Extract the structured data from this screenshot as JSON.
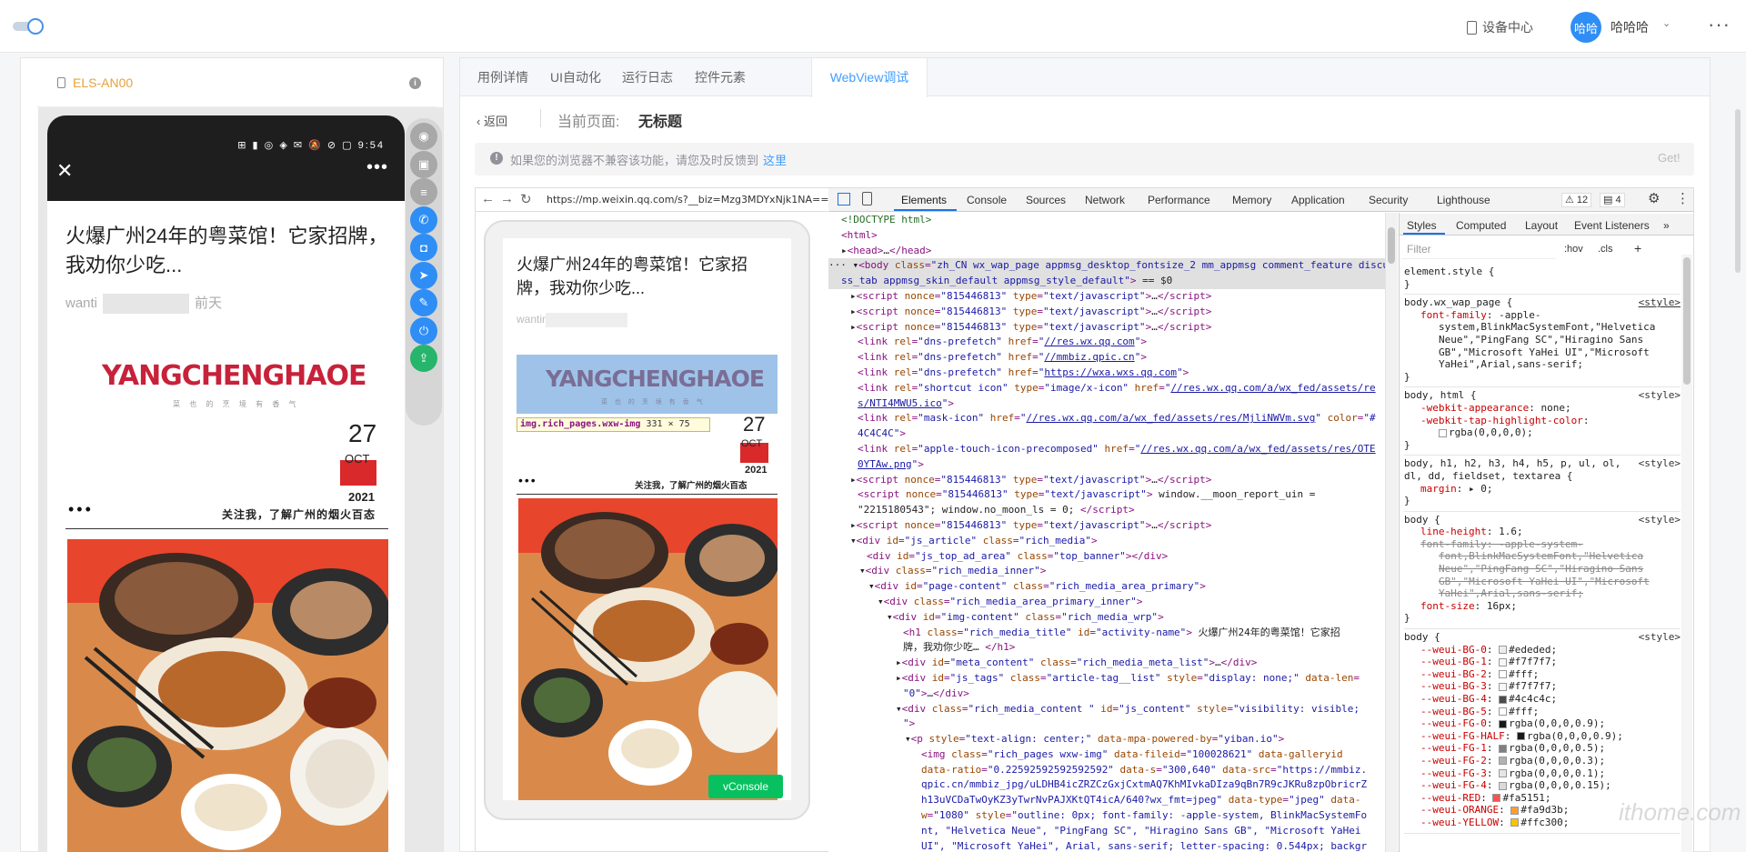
{
  "topbar": {
    "device_center": "设备中心",
    "avatar_text": "哈哈",
    "user_name": "哈哈哈",
    "caret": "⌄",
    "more": "···"
  },
  "device_panel": {
    "device_name": "ELS-AN00",
    "info": "i",
    "status_icons": "⊞ ▮ ◎ ◈ ✉ 🔕 ⊘ ▢ 9:54",
    "close": "✕",
    "dots": "•••"
  },
  "article": {
    "title": "火爆广州24年的粤菜馆！它家招牌，我劝你少吃...",
    "author": "wanti",
    "time": "前天",
    "brand": "YANGCHENGHAOE",
    "brand_sub": "菜 也 的 烹 境 有 香 气",
    "day": "27",
    "month": "OCT",
    "year": "2021",
    "dots": "•••",
    "follow": "关注我，了解广州的烟火百态"
  },
  "tools": [
    {
      "name": "eye-icon",
      "glyph": "◉",
      "color": "#a8a8a8"
    },
    {
      "name": "folder-icon",
      "glyph": "▣",
      "color": "#a8a8a8"
    },
    {
      "name": "sliders-icon",
      "glyph": "≡",
      "color": "#a8a8a8"
    },
    {
      "name": "phone-call-icon",
      "glyph": "✆",
      "color": "#2e8ef5"
    },
    {
      "name": "camera-icon",
      "glyph": "◘",
      "color": "#2e8ef5"
    },
    {
      "name": "location-icon",
      "glyph": "➤",
      "color": "#2e8ef5"
    },
    {
      "name": "edit-icon",
      "glyph": "✎",
      "color": "#2e8ef5"
    },
    {
      "name": "power-icon",
      "glyph": "⏻",
      "color": "#2e8ef5"
    },
    {
      "name": "upload-icon",
      "glyph": "⇪",
      "color": "#26b56a"
    }
  ],
  "tabs": [
    "用例详情",
    "UI自动化",
    "运行日志",
    "控件元素",
    "WebView调试"
  ],
  "page_header": {
    "back": "返回",
    "current_label": "当前页面:",
    "current_value": "无标题"
  },
  "notice": {
    "text": "如果您的浏览器不兼容该功能，请您及时反馈到",
    "link": "这里",
    "got": "Get!"
  },
  "browser": {
    "url": "https://mp.weixin.qq.com/s?__biz=Mzg3MDYxNjk1NA==",
    "back": "←",
    "forward": "→",
    "reload": "↻"
  },
  "preview": {
    "title": "火爆广州24年的粤菜馆！它家招牌，我劝你少吃...",
    "author": "wantir",
    "logo": "YANGCHENGHAOE",
    "sub": "菜 也 的 烹 境 有 香 气",
    "tooltip_sel": "img.rich_pages.wxw-img",
    "tooltip_size": "331 × 75",
    "day": "27",
    "month": "OCT",
    "year": "2021",
    "dots": "•••",
    "follow": "关注我，了解广州的烟火百态",
    "vconsole": "vConsole"
  },
  "devtools": {
    "tabs": [
      "Elements",
      "Console",
      "Sources",
      "Network",
      "Performance",
      "Memory",
      "Application",
      "Security",
      "Lighthouse"
    ],
    "warn_badge": "⚠ 12",
    "info_badge": "▤ 4",
    "gear": "⚙",
    "kebab": "⋮"
  },
  "styles_panel": {
    "tabs": [
      "Styles",
      "Computed",
      "Layout",
      "Event Listeners",
      "»"
    ],
    "filter_placeholder": "Filter",
    "hov": ":hov",
    "cls": ".cls",
    "plus": "+"
  },
  "watermark": "ithome.com"
}
